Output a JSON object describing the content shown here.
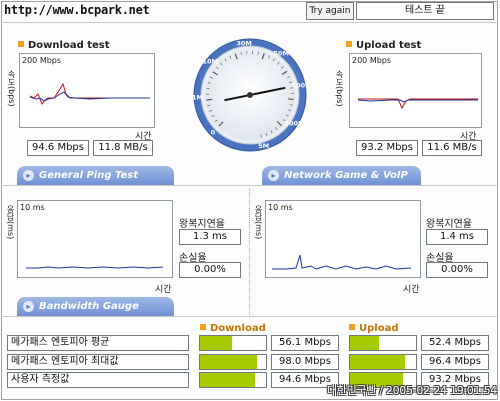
{
  "header": {
    "url": "http://www.bcpark.net",
    "try_again": "Try again",
    "end_test": "테스트 끝"
  },
  "download": {
    "title": "Download test",
    "scale": "200 Mbps",
    "ylabel": "속도(bps)",
    "xlabel": "시간",
    "mbps": "94.6 Mbps",
    "mbs": "11.8 MB/s"
  },
  "upload": {
    "title": "Upload test",
    "scale": "200 Mbps",
    "ylabel": "속도(bps)",
    "xlabel": "시간",
    "mbps": "93.2 Mbps",
    "mbs": "11.6 MB/s"
  },
  "tabs": {
    "ping": "General Ping Test",
    "game": "Network Game & VoIP Test",
    "bandwidth": "Bandwidth Gauge"
  },
  "ping_left": {
    "scale": "10 ms",
    "ylabel": "응답(ms)",
    "xlabel": "시간",
    "latency_label": "왕복지연율",
    "latency_value": "1.3 ms",
    "loss_label": "손실율",
    "loss_value": "0.00%"
  },
  "ping_right": {
    "scale": "10 ms",
    "ylabel": "응답(ms)",
    "xlabel": "시간",
    "latency_label": "왕복지연율",
    "latency_value": "1.4 ms",
    "loss_label": "손실율",
    "loss_value": "0.00%"
  },
  "gauge": {
    "ticks": [
      "0",
      "1M",
      "10M",
      "30M",
      "50M",
      "100M",
      "200M",
      "5M"
    ],
    "needle_mbps": 94.6
  },
  "bandwidth": {
    "download_header": "Download",
    "upload_header": "Upload",
    "rows": [
      {
        "label": "메가패스 엔토피아 평균",
        "download": "56.1 Mbps",
        "download_fill": 0.48,
        "upload": "52.4 Mbps",
        "upload_fill": 0.44
      },
      {
        "label": "메가패스 엔토피아 최대값",
        "download": "98.0 Mbps",
        "download_fill": 0.86,
        "upload": "96.4 Mbps",
        "upload_fill": 0.84
      },
      {
        "label": "사용자 측정값",
        "download": "94.6 Mbps",
        "download_fill": 0.83,
        "upload": "93.2 Mbps",
        "upload_fill": 0.8
      }
    ]
  },
  "watermark": "대한민국빤 / 2005-02-24 19:01:54",
  "colors": {
    "tab": "#7b9bd9",
    "bar": "#a6cc00",
    "accent": "#f0a020",
    "series_red": "#c01818",
    "series_blue": "#2030a0"
  }
}
